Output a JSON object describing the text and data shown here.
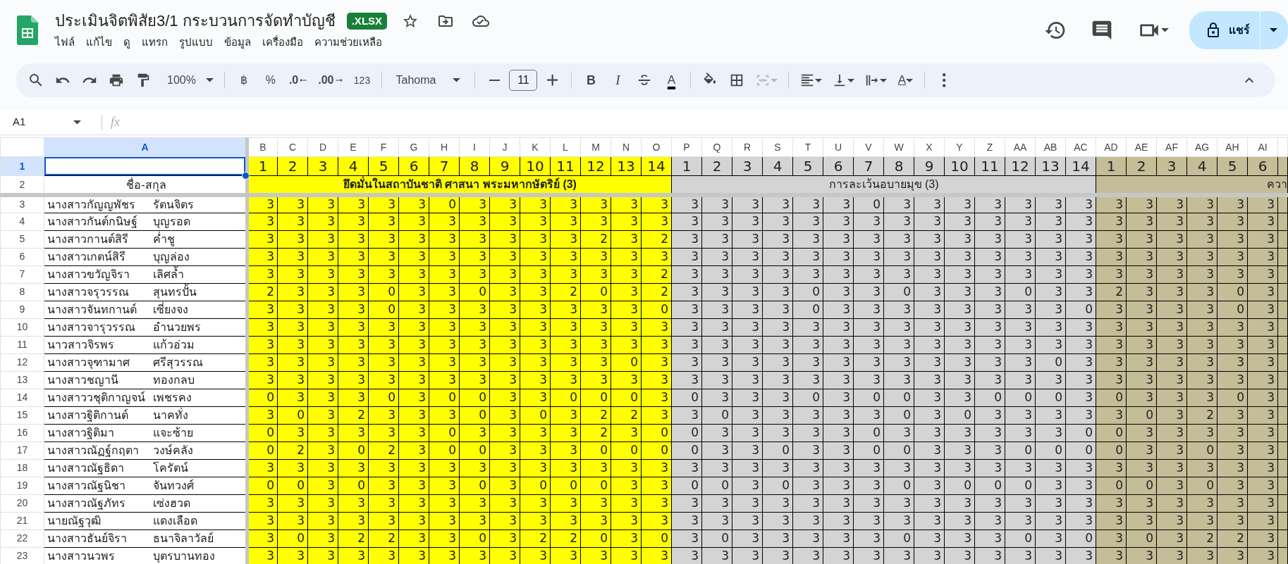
{
  "title": "ประเมินจิตพิสัย3/1 กระบวนการจัดทำบัญชี",
  "file_badge": ".XLSX",
  "menu": [
    "ไฟล์",
    "แก้ไข",
    "ดู",
    "แทรก",
    "รูปแบบ",
    "ข้อมูล",
    "เครื่องมือ",
    "ความช่วยเหลือ"
  ],
  "share_button": "แชร์",
  "toolbar": {
    "zoom": "100%",
    "currency": "฿",
    "percent": "%",
    "decrease_decimal": ".0",
    "increase_decimal": ".00",
    "number_format": "123",
    "font": "Tahoma",
    "font_size": "11",
    "bold": "B",
    "italic": "I",
    "text_color": "A",
    "text_rotation": "A"
  },
  "name_box": "A1",
  "formula_label": "fx",
  "columns": [
    {
      "label": "A",
      "selected": true
    },
    {
      "label": "B",
      "selected": false
    },
    {
      "label": "C",
      "selected": false
    },
    {
      "label": "D",
      "selected": false
    },
    {
      "label": "E",
      "selected": false
    },
    {
      "label": "F",
      "selected": false
    },
    {
      "label": "G",
      "selected": false
    },
    {
      "label": "H",
      "selected": false
    },
    {
      "label": "I",
      "selected": false
    },
    {
      "label": "J",
      "selected": false
    },
    {
      "label": "K",
      "selected": false
    },
    {
      "label": "L",
      "selected": false
    },
    {
      "label": "M",
      "selected": false
    },
    {
      "label": "N",
      "selected": false
    },
    {
      "label": "O",
      "selected": false
    },
    {
      "label": "P",
      "selected": false
    },
    {
      "label": "Q",
      "selected": false
    },
    {
      "label": "R",
      "selected": false
    },
    {
      "label": "S",
      "selected": false
    },
    {
      "label": "T",
      "selected": false
    },
    {
      "label": "U",
      "selected": false
    },
    {
      "label": "V",
      "selected": false
    },
    {
      "label": "W",
      "selected": false
    },
    {
      "label": "X",
      "selected": false
    },
    {
      "label": "Y",
      "selected": false
    },
    {
      "label": "Z",
      "selected": false
    },
    {
      "label": "AA",
      "selected": false
    },
    {
      "label": "AB",
      "selected": false
    },
    {
      "label": "AC",
      "selected": false
    },
    {
      "label": "AD",
      "selected": false
    },
    {
      "label": "AE",
      "selected": false
    },
    {
      "label": "AF",
      "selected": false
    },
    {
      "label": "AG",
      "selected": false
    },
    {
      "label": "AH",
      "selected": false
    },
    {
      "label": "AI",
      "selected": false
    }
  ],
  "header_rows": [
    {
      "number": "1",
      "selected": true
    },
    {
      "number": "2",
      "selected": false,
      "name_header": "ชื่อ-สกุล"
    }
  ],
  "groups": [
    {
      "label": "ยึดมั่นในสถาบันชาติ ศาสนา พระมหากษัตริย์ (3)",
      "bold": true,
      "color": "#ffff00",
      "numbers": [
        "1",
        "2",
        "3",
        "4",
        "5",
        "6",
        "7",
        "8",
        "9",
        "10",
        "11",
        "12",
        "13",
        "14"
      ]
    },
    {
      "label": "การละเว้นอบายมุข (3)",
      "bold": false,
      "color": "#d4d4d4",
      "numbers": [
        "1",
        "2",
        "3",
        "4",
        "5",
        "6",
        "7",
        "8",
        "9",
        "10",
        "11",
        "12",
        "13",
        "14"
      ]
    },
    {
      "label": "ควา",
      "bold": false,
      "color": "#c4bd97",
      "numbers": [
        "1",
        "2",
        "3",
        "4",
        "5",
        "6"
      ]
    }
  ],
  "rows": [
    {
      "number": "3",
      "selected": false,
      "given": "นางสาวกัญญพัชร",
      "surname": "รัตนจิตร",
      "values": [
        "3",
        "3",
        "3",
        "3",
        "3",
        "3",
        "0",
        "3",
        "3",
        "3",
        "3",
        "3",
        "3",
        "3",
        "3",
        "3",
        "3",
        "3",
        "3",
        "3",
        "0",
        "3",
        "3",
        "3",
        "3",
        "3",
        "3",
        "3",
        "3",
        "3",
        "3",
        "3",
        "3",
        "3"
      ]
    },
    {
      "number": "4",
      "selected": false,
      "given": "นางสาวกันต์กนิษฐ์",
      "surname": "บุญรอด",
      "values": [
        "3",
        "3",
        "3",
        "3",
        "3",
        "3",
        "3",
        "3",
        "3",
        "3",
        "3",
        "3",
        "3",
        "3",
        "3",
        "3",
        "3",
        "3",
        "3",
        "3",
        "3",
        "3",
        "3",
        "3",
        "3",
        "3",
        "3",
        "3",
        "3",
        "3",
        "3",
        "3",
        "3",
        "3"
      ]
    },
    {
      "number": "5",
      "selected": false,
      "given": "นางสาวกานต์สิรี",
      "surname": "ค่ำชู",
      "values": [
        "3",
        "3",
        "3",
        "3",
        "3",
        "3",
        "3",
        "3",
        "3",
        "3",
        "3",
        "2",
        "3",
        "2",
        "3",
        "3",
        "3",
        "3",
        "3",
        "3",
        "3",
        "3",
        "3",
        "3",
        "3",
        "3",
        "3",
        "3",
        "3",
        "3",
        "3",
        "3",
        "3",
        "3"
      ]
    },
    {
      "number": "6",
      "selected": false,
      "given": "นางสาวเกตน์สิรี",
      "surname": "บุญล่อง",
      "values": [
        "3",
        "3",
        "3",
        "3",
        "3",
        "3",
        "3",
        "3",
        "3",
        "3",
        "3",
        "3",
        "3",
        "3",
        "3",
        "3",
        "3",
        "3",
        "3",
        "3",
        "3",
        "3",
        "3",
        "3",
        "3",
        "3",
        "3",
        "3",
        "3",
        "3",
        "3",
        "3",
        "3",
        "3"
      ]
    },
    {
      "number": "7",
      "selected": false,
      "given": "นางสาวขวัญจิรา",
      "surname": "เลิศล้ำ",
      "values": [
        "3",
        "3",
        "3",
        "3",
        "3",
        "3",
        "3",
        "3",
        "3",
        "3",
        "3",
        "3",
        "3",
        "2",
        "3",
        "3",
        "3",
        "3",
        "3",
        "3",
        "3",
        "3",
        "3",
        "3",
        "3",
        "3",
        "3",
        "3",
        "3",
        "3",
        "3",
        "3",
        "3",
        "3"
      ]
    },
    {
      "number": "8",
      "selected": false,
      "given": "นางสาวจรุวรรณ",
      "surname": "สุนทรปั้น",
      "values": [
        "2",
        "3",
        "3",
        "3",
        "0",
        "3",
        "3",
        "0",
        "3",
        "3",
        "2",
        "0",
        "3",
        "2",
        "3",
        "3",
        "3",
        "3",
        "0",
        "3",
        "3",
        "0",
        "3",
        "3",
        "3",
        "0",
        "3",
        "3",
        "2",
        "3",
        "3",
        "3",
        "0",
        "3"
      ]
    },
    {
      "number": "9",
      "selected": false,
      "given": "นางสาวจันทกานต์",
      "surname": "เซี่ยงจง",
      "values": [
        "3",
        "3",
        "3",
        "3",
        "0",
        "3",
        "3",
        "3",
        "3",
        "3",
        "3",
        "3",
        "3",
        "0",
        "3",
        "3",
        "3",
        "3",
        "0",
        "3",
        "3",
        "3",
        "3",
        "3",
        "3",
        "3",
        "3",
        "0",
        "3",
        "3",
        "3",
        "3",
        "0",
        "3"
      ]
    },
    {
      "number": "10",
      "selected": false,
      "given": "นางสาวจารุวรรณ",
      "surname": "อำนวยพร",
      "values": [
        "3",
        "3",
        "3",
        "3",
        "3",
        "3",
        "3",
        "3",
        "3",
        "3",
        "3",
        "3",
        "3",
        "3",
        "3",
        "3",
        "3",
        "3",
        "3",
        "3",
        "3",
        "3",
        "3",
        "3",
        "3",
        "3",
        "3",
        "3",
        "3",
        "3",
        "3",
        "3",
        "3",
        "3"
      ]
    },
    {
      "number": "11",
      "selected": false,
      "given": "นาวสาวจิรพร",
      "surname": "แก้วอ่วม",
      "values": [
        "3",
        "3",
        "3",
        "3",
        "3",
        "3",
        "3",
        "3",
        "3",
        "3",
        "3",
        "3",
        "3",
        "3",
        "3",
        "3",
        "3",
        "3",
        "3",
        "3",
        "3",
        "3",
        "3",
        "3",
        "3",
        "3",
        "3",
        "3",
        "3",
        "3",
        "3",
        "3",
        "3",
        "3"
      ]
    },
    {
      "number": "12",
      "selected": false,
      "given": "นางสาวจุฑามาศ",
      "surname": "ศรีสุวรรณ",
      "values": [
        "3",
        "3",
        "3",
        "3",
        "3",
        "3",
        "3",
        "3",
        "3",
        "3",
        "3",
        "3",
        "0",
        "3",
        "3",
        "3",
        "3",
        "3",
        "3",
        "3",
        "3",
        "3",
        "3",
        "3",
        "3",
        "3",
        "0",
        "3",
        "3",
        "3",
        "3",
        "3",
        "3",
        "3"
      ]
    },
    {
      "number": "13",
      "selected": false,
      "given": "นางสาวชญานี",
      "surname": "ทองกลบ",
      "values": [
        "3",
        "3",
        "3",
        "3",
        "3",
        "3",
        "3",
        "3",
        "3",
        "3",
        "3",
        "3",
        "3",
        "3",
        "3",
        "3",
        "3",
        "3",
        "3",
        "3",
        "3",
        "3",
        "3",
        "3",
        "3",
        "3",
        "3",
        "3",
        "3",
        "3",
        "3",
        "3",
        "3",
        "3"
      ]
    },
    {
      "number": "14",
      "selected": false,
      "given": "นางสาววชุติกาญจน์",
      "surname": "เพชรคง",
      "values": [
        "0",
        "3",
        "3",
        "3",
        "0",
        "3",
        "0",
        "0",
        "3",
        "3",
        "0",
        "0",
        "0",
        "3",
        "0",
        "3",
        "3",
        "3",
        "0",
        "3",
        "0",
        "0",
        "3",
        "3",
        "0",
        "0",
        "0",
        "3",
        "0",
        "3",
        "3",
        "3",
        "0",
        "3"
      ]
    },
    {
      "number": "15",
      "selected": false,
      "given": "นางสาวฐิติกานต์",
      "surname": "นาคทั่ง",
      "values": [
        "3",
        "0",
        "3",
        "2",
        "3",
        "3",
        "3",
        "0",
        "3",
        "0",
        "3",
        "2",
        "2",
        "3",
        "3",
        "0",
        "3",
        "3",
        "3",
        "3",
        "3",
        "0",
        "3",
        "0",
        "3",
        "3",
        "3",
        "3",
        "3",
        "0",
        "3",
        "2",
        "3",
        "3"
      ]
    },
    {
      "number": "16",
      "selected": false,
      "given": "นางสาวฐิติมา",
      "surname": "แจะซ้าย",
      "values": [
        "0",
        "3",
        "3",
        "3",
        "3",
        "3",
        "0",
        "3",
        "3",
        "3",
        "3",
        "2",
        "3",
        "0",
        "0",
        "3",
        "3",
        "3",
        "3",
        "3",
        "0",
        "3",
        "3",
        "3",
        "3",
        "3",
        "3",
        "0",
        "0",
        "3",
        "3",
        "3",
        "3",
        "3"
      ]
    },
    {
      "number": "17",
      "selected": false,
      "given": "นางสาวณัฏฐ์กฤตา",
      "surname": "วงษ์คลัง",
      "values": [
        "0",
        "2",
        "3",
        "0",
        "2",
        "3",
        "0",
        "0",
        "3",
        "3",
        "3",
        "0",
        "0",
        "0",
        "0",
        "3",
        "3",
        "0",
        "3",
        "3",
        "0",
        "0",
        "3",
        "3",
        "3",
        "0",
        "0",
        "0",
        "0",
        "3",
        "3",
        "0",
        "3",
        "3"
      ]
    },
    {
      "number": "18",
      "selected": false,
      "given": "นางสาวณัฐธิดา",
      "surname": "โครัตน์",
      "values": [
        "3",
        "3",
        "3",
        "3",
        "3",
        "3",
        "3",
        "3",
        "3",
        "3",
        "3",
        "3",
        "3",
        "3",
        "3",
        "3",
        "3",
        "3",
        "3",
        "3",
        "3",
        "3",
        "3",
        "3",
        "3",
        "3",
        "3",
        "3",
        "3",
        "3",
        "3",
        "3",
        "3",
        "3"
      ]
    },
    {
      "number": "19",
      "selected": false,
      "given": "นางสาวณัฐนิชา",
      "surname": "จันทวงศ์",
      "values": [
        "0",
        "0",
        "3",
        "0",
        "3",
        "3",
        "3",
        "0",
        "3",
        "0",
        "0",
        "0",
        "3",
        "3",
        "0",
        "0",
        "3",
        "0",
        "3",
        "3",
        "3",
        "0",
        "3",
        "0",
        "0",
        "0",
        "3",
        "3",
        "0",
        "0",
        "3",
        "0",
        "3",
        "3"
      ]
    },
    {
      "number": "20",
      "selected": false,
      "given": "นางสาวณัฐภัทร",
      "surname": "เซ่งฮวด",
      "values": [
        "3",
        "3",
        "3",
        "3",
        "3",
        "3",
        "3",
        "3",
        "3",
        "3",
        "3",
        "3",
        "3",
        "3",
        "3",
        "3",
        "3",
        "3",
        "3",
        "3",
        "3",
        "3",
        "3",
        "3",
        "3",
        "3",
        "3",
        "3",
        "3",
        "3",
        "3",
        "3",
        "3",
        "3"
      ]
    },
    {
      "number": "21",
      "selected": false,
      "given": "นายณัฐวุฒิ",
      "surname": "แดงเลือด",
      "values": [
        "3",
        "3",
        "3",
        "3",
        "3",
        "3",
        "3",
        "3",
        "3",
        "3",
        "3",
        "3",
        "3",
        "3",
        "3",
        "3",
        "3",
        "3",
        "3",
        "3",
        "3",
        "3",
        "3",
        "3",
        "3",
        "3",
        "3",
        "3",
        "3",
        "3",
        "3",
        "3",
        "3",
        "3"
      ]
    },
    {
      "number": "22",
      "selected": false,
      "given": "นางสาวธันย์จิรา",
      "surname": "ธนาจิลาวัลย์",
      "values": [
        "3",
        "0",
        "3",
        "2",
        "2",
        "3",
        "3",
        "0",
        "3",
        "2",
        "2",
        "0",
        "3",
        "0",
        "3",
        "0",
        "3",
        "3",
        "3",
        "3",
        "3",
        "0",
        "3",
        "3",
        "3",
        "0",
        "3",
        "0",
        "3",
        "0",
        "3",
        "2",
        "2",
        "3"
      ]
    },
    {
      "number": "23",
      "selected": false,
      "given": "นางสาวนวพร",
      "surname": "บุตรบานทอง",
      "values": [
        "3",
        "3",
        "3",
        "3",
        "3",
        "3",
        "3",
        "3",
        "3",
        "3",
        "3",
        "3",
        "3",
        "3",
        "3",
        "3",
        "3",
        "3",
        "3",
        "3",
        "3",
        "3",
        "3",
        "3",
        "3",
        "3",
        "3",
        "3",
        "3",
        "3",
        "3",
        "3",
        "3",
        "3"
      ]
    }
  ]
}
